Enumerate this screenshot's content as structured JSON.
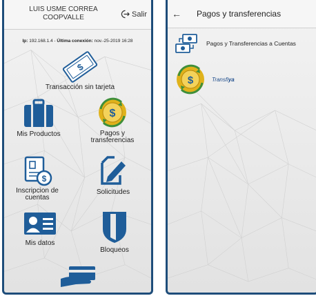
{
  "left_screen": {
    "header": {
      "user_line1": "LUIS USME CORREA",
      "user_line2": "COOPVALLE",
      "logout_label": "Salir"
    },
    "session": {
      "ip_label": "Ip:",
      "ip_value": "192.168.1.4",
      "last_login_label": "Última conexión:",
      "last_login_value": "nov.-25-2019 16:28"
    },
    "menu": {
      "cardless": "Transacción sin tarjeta",
      "products": "Mis Productos",
      "payments_line1": "Pagos y",
      "payments_line2": "transferencias",
      "accounts_line1": "Inscripcion de",
      "accounts_line2": "cuentas",
      "requests": "Solicitudes",
      "my_data": "Mis datos",
      "blocks": "Bloqueos"
    }
  },
  "right_screen": {
    "header": {
      "back": "←",
      "title": "Pagos y transferencias"
    },
    "options": {
      "accounts_transfer": "Pagos y Transferencias a Cuentas",
      "transfiya_prefix": "Transfi",
      "transfiya_suffix": "ya"
    }
  },
  "colors": {
    "primary": "#1e4d7a",
    "icon_blue": "#1f5d99",
    "gold": "#e0b21b",
    "green": "#3f8f3a"
  }
}
